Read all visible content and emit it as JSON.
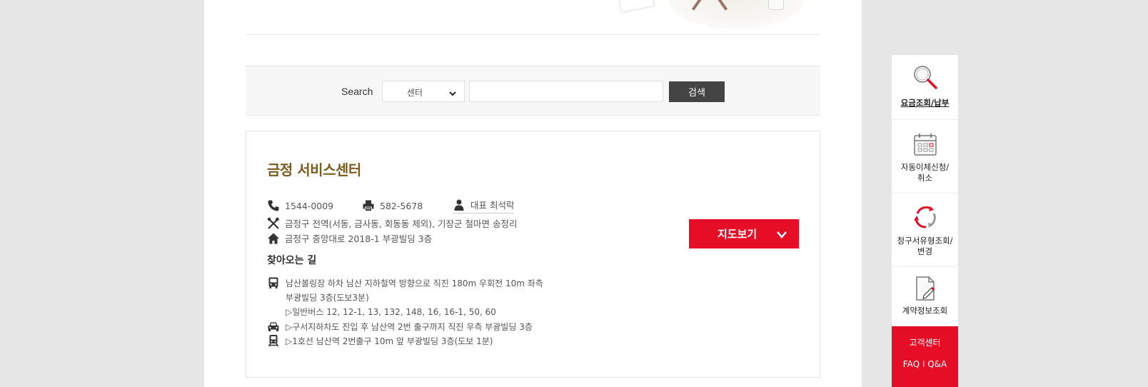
{
  "search": {
    "label": "Search",
    "select_value": "센터",
    "input_value": "",
    "button_label": "검색"
  },
  "center": {
    "title": "금정 서비스센터",
    "phone": "1544-0009",
    "fax": "582-5678",
    "representative": "대표 최석락",
    "service_area": "금정구 전역(서동, 금사동, 회동동 제외), 기장군 철마면 송정리",
    "address": "금정구 중앙대로 2018-1 부광빌딩 3층",
    "map_button_label": "지도보기",
    "directions_title": "찾아오는 길",
    "directions": {
      "bus": [
        "남산볼링장 하차 남산 지하철역 방향으로 직진 180m 우회전 10m 좌측",
        "부광빌딩 3층(도보3분)",
        "▷일반버스 12, 12-1, 13, 132, 148, 16, 16-1, 50, 60"
      ],
      "car": "▷구서지하차도 진입 후 남산역 2번 출구까지 직진 우측 부광빌딩 3층",
      "train": "▷1호선 남산역 2번출구 10m 앞 부광빌딩 3층(도보 1분)"
    }
  },
  "quick_menu": {
    "items": [
      {
        "label": "요금조회/납부",
        "icon": "magnifier-icon"
      },
      {
        "label": "자동이체신청/\n취소",
        "icon": "calendar-icon"
      },
      {
        "label": "청구서유형조회/\n변경",
        "icon": "refresh-cycle-icon"
      },
      {
        "label": "계약정보조회",
        "icon": "document-pen-icon"
      }
    ],
    "customer_center": {
      "title": "고객센터",
      "links": "FAQ I Q&A"
    }
  },
  "colors": {
    "accent_red": "#e60e27",
    "title_brown": "#7a5c1e",
    "dark_button": "#444444"
  }
}
